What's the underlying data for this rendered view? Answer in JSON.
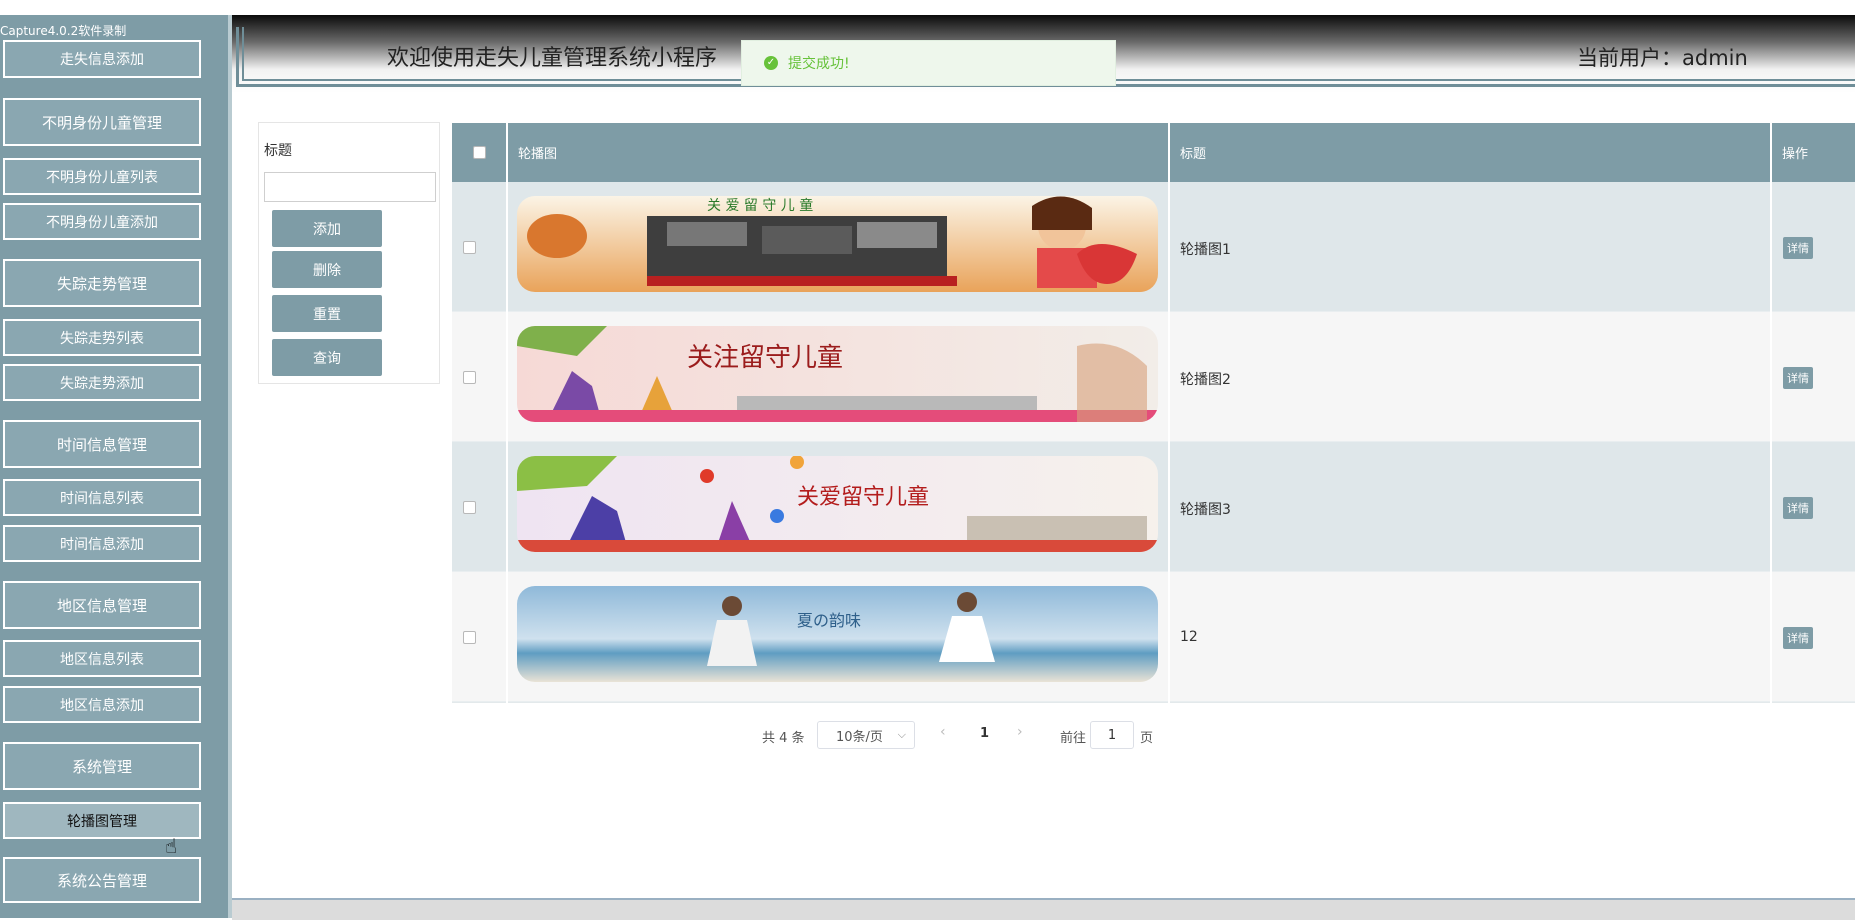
{
  "overlay": {
    "capture_label": "Capture4.0.2软件录制"
  },
  "sidebar": {
    "items": [
      {
        "label": "走失信息添加",
        "type": "sub"
      },
      {
        "label": "不明身份儿童管理",
        "type": "major"
      },
      {
        "label": "不明身份儿童列表",
        "type": "sub"
      },
      {
        "label": "不明身份儿童添加",
        "type": "sub"
      },
      {
        "label": "失踪走势管理",
        "type": "major"
      },
      {
        "label": "失踪走势列表",
        "type": "sub"
      },
      {
        "label": "失踪走势添加",
        "type": "sub"
      },
      {
        "label": "时间信息管理",
        "type": "major"
      },
      {
        "label": "时间信息列表",
        "type": "sub"
      },
      {
        "label": "时间信息添加",
        "type": "sub"
      },
      {
        "label": "地区信息管理",
        "type": "major"
      },
      {
        "label": "地区信息列表",
        "type": "sub"
      },
      {
        "label": "地区信息添加",
        "type": "sub"
      },
      {
        "label": "系统管理",
        "type": "major"
      },
      {
        "label": "轮播图管理",
        "type": "sub",
        "active": true
      },
      {
        "label": "系统公告管理",
        "type": "major"
      }
    ]
  },
  "header": {
    "welcome": "欢迎使用走失儿童管理系统小程序",
    "current_user": "当前用户：admin"
  },
  "toast": {
    "message": "提交成功!"
  },
  "search": {
    "label": "标题",
    "value": "",
    "buttons": {
      "add": "添加",
      "delete": "删除",
      "reset": "重置",
      "query": "查询"
    }
  },
  "table": {
    "headers": {
      "image": "轮播图",
      "title": "标题",
      "action": "操作"
    },
    "rows": [
      {
        "title": "轮播图1",
        "action": "详情"
      },
      {
        "title": "轮播图2",
        "action": "详情"
      },
      {
        "title": "轮播图3",
        "action": "详情"
      },
      {
        "title": "12",
        "action": "详情"
      }
    ]
  },
  "pagination": {
    "total": "共 4 条",
    "page_size": "10条/页",
    "current_page": "1",
    "goto_label": "前往",
    "goto_value": "1",
    "page_unit": "页"
  },
  "colors": {
    "accent": "#7e9ca6",
    "success": "#67c23a"
  }
}
